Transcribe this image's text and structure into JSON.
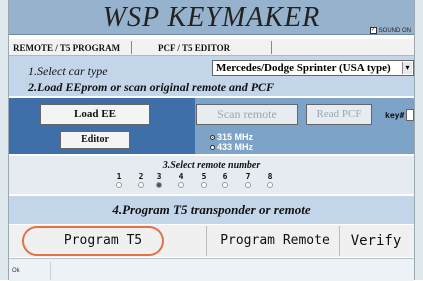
{
  "app": {
    "title": "WSP  KEYMAKER",
    "sound_label": "SOUND ON"
  },
  "tabs": [
    {
      "label": "REMOTE / T5 PROGRAM"
    },
    {
      "label": "PCF / T5  EDITOR"
    }
  ],
  "step1": {
    "label": "1.Select car type",
    "selected": "Mercedes/Dodge Sprinter (USA type)"
  },
  "step2": {
    "label": "2.Load EEprom or scan original remote and PCF"
  },
  "buttons": {
    "load_ee": "Load EE",
    "editor": "Editor",
    "scan_remote": "Scan remote",
    "read_pcf": "Read PCF",
    "program_t5": "Program T5",
    "program_remote": "Program Remote",
    "verify": "Verify"
  },
  "key_label": "key#",
  "frequencies": [
    {
      "label": "315 MHz",
      "selected": true
    },
    {
      "label": "433 MHz",
      "selected": false
    }
  ],
  "step3": {
    "label": "3.Select remote number",
    "numbers": [
      "1",
      "2",
      "3",
      "4",
      "5",
      "6",
      "7",
      "8"
    ],
    "selected_index": 2
  },
  "step4": {
    "label": "4.Program T5 transponder or remote"
  },
  "status": {
    "text": "Ok"
  }
}
